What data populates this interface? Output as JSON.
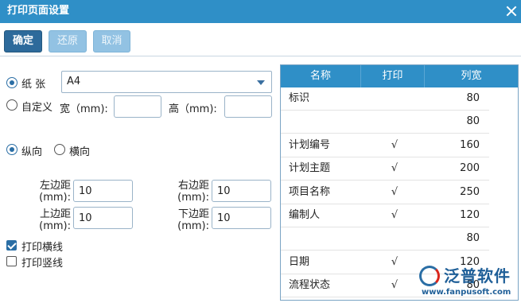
{
  "dialog": {
    "title": "打印页面设置"
  },
  "toolbar": {
    "confirm": "确定",
    "restore": "还原",
    "cancel": "取消"
  },
  "paper": {
    "option_label": "纸 张",
    "selected": "A4",
    "custom_label": "自定义",
    "width_label": "宽（mm):",
    "height_label": "高（mm):",
    "width_value": "",
    "height_value": ""
  },
  "orientation": {
    "portrait": "纵向",
    "landscape": "横向",
    "selected": "portrait"
  },
  "margins": {
    "left_label_1": "左边距",
    "left_label_2": "(mm):",
    "left_value": "10",
    "right_label_1": "右边距",
    "right_label_2": "(mm):",
    "right_value": "10",
    "top_label_1": "上边距",
    "top_label_2": "(mm):",
    "top_value": "10",
    "bottom_label_1": "下边距",
    "bottom_label_2": "(mm):",
    "bottom_value": "10"
  },
  "lines": {
    "horizontal": "打印横线",
    "horizontal_checked": true,
    "vertical": "打印竖线",
    "vertical_checked": false
  },
  "columns_table": {
    "headers": [
      "名称",
      "打印",
      "列宽"
    ],
    "rows": [
      {
        "name": "标识",
        "print": "",
        "width": "80"
      },
      {
        "name": "",
        "print": "",
        "width": "80"
      },
      {
        "name": "计划编号",
        "print": "√",
        "width": "160"
      },
      {
        "name": "计划主题",
        "print": "√",
        "width": "200"
      },
      {
        "name": "项目名称",
        "print": "√",
        "width": "250"
      },
      {
        "name": "编制人",
        "print": "√",
        "width": "120"
      },
      {
        "name": "",
        "print": "",
        "width": "80"
      },
      {
        "name": "日期",
        "print": "√",
        "width": "120"
      },
      {
        "name": "流程状态",
        "print": "√",
        "width": "80"
      }
    ]
  },
  "watermark": {
    "brand": "泛普软件",
    "url": "www.fanpusoft.com"
  }
}
